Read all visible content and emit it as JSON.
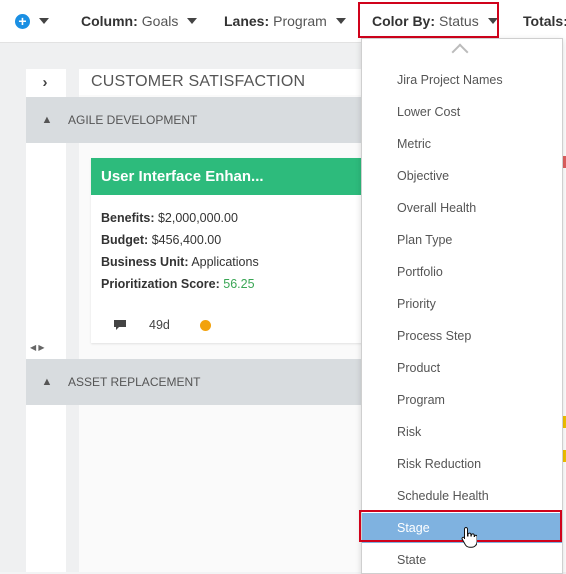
{
  "toolbar": {
    "column_label": "Column:",
    "column_value": "Goals",
    "lanes_label": "Lanes:",
    "lanes_value": "Program",
    "color_label": "Color By:",
    "color_value": "Status",
    "totals_label": "Totals:"
  },
  "board": {
    "column_title": "CUSTOMER SATISFACTION",
    "lanes": [
      {
        "title": "AGILE DEVELOPMENT"
      },
      {
        "title": "ASSET REPLACEMENT"
      }
    ],
    "card": {
      "title": "User Interface Enhan...",
      "benefits_label": "Benefits:",
      "benefits_value": "$2,000,000.00",
      "budget_label": "Budget:",
      "budget_value": "$456,400.00",
      "unit_label": "Business Unit:",
      "unit_value": "Applications",
      "score_label": "Prioritization Score:",
      "score_value": "56.25",
      "age": "49d",
      "status_color": "#f2a20d",
      "header_color": "#2dbb7c"
    }
  },
  "dropdown": {
    "items": [
      "Jira Project Names",
      "Lower Cost",
      "Metric",
      "Objective",
      "Overall Health",
      "Plan Type",
      "Portfolio",
      "Priority",
      "Process Step",
      "Product",
      "Program",
      "Risk",
      "Risk Reduction",
      "Schedule Health",
      "Stage",
      "State"
    ],
    "selected": "Stage"
  },
  "colors": {
    "accent": "#1a8fe3",
    "highlight_border": "#d0021b",
    "selected_item": "#7fb2e0"
  }
}
